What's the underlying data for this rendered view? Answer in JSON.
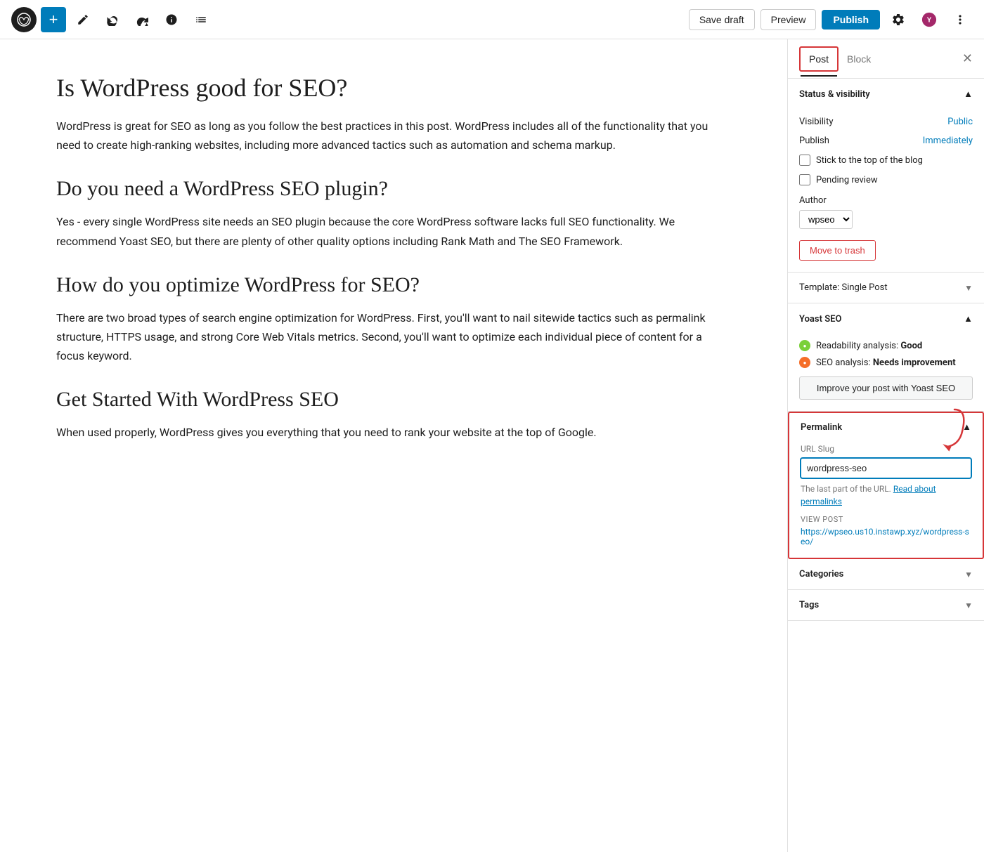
{
  "toolbar": {
    "add_label": "+",
    "save_draft_label": "Save draft",
    "preview_label": "Preview",
    "publish_label": "Publish"
  },
  "editor": {
    "sections": [
      {
        "heading": "Is WordPress good for SEO?",
        "body": "WordPress is great for SEO as long as you follow the best practices in this post. WordPress includes all of the functionality that you need to create high-ranking websites, including more advanced tactics such as automation and schema markup."
      },
      {
        "heading": "Do you need a WordPress SEO plugin?",
        "body": "Yes - every single WordPress site needs an SEO plugin because the core WordPress software lacks full SEO functionality. We recommend Yoast SEO, but there are plenty of other quality options including Rank Math and The SEO Framework."
      },
      {
        "heading": "How do you optimize WordPress for SEO?",
        "body": "There are two broad types of search engine optimization for WordPress. First, you'll want to nail sitewide tactics such as permalink structure, HTTPS usage, and strong Core Web Vitals metrics. Second, you'll want to optimize each individual piece of content for a focus keyword."
      },
      {
        "heading": "Get Started With WordPress SEO",
        "body": "When used properly, WordPress gives you everything that you need to rank your website at the top of Google."
      }
    ]
  },
  "sidebar": {
    "tabs": {
      "post_label": "Post",
      "block_label": "Block"
    },
    "status_visibility": {
      "heading": "Status & visibility",
      "visibility_label": "Visibility",
      "visibility_value": "Public",
      "publish_label": "Publish",
      "publish_value": "Immediately",
      "stick_top_label": "Stick to the top of the blog",
      "pending_review_label": "Pending review",
      "author_label": "Author",
      "author_value": "wpseo",
      "trash_label": "Move to trash"
    },
    "template": {
      "label": "Template: Single Post"
    },
    "yoast": {
      "heading": "Yoast SEO",
      "readability_label": "Readability analysis: ",
      "readability_value": "Good",
      "seo_label": "SEO analysis: ",
      "seo_value": "Needs improvement",
      "improve_btn": "Improve your post with Yoast SEO"
    },
    "permalink": {
      "heading": "Permalink",
      "slug_label": "URL Slug",
      "slug_value": "wordpress-seo",
      "desc_text": "The last part of the URL. ",
      "read_about_label": "Read about permalinks",
      "view_post_label": "VIEW POST",
      "view_post_url": "https://wpseo.us10.instawp.xyz/wordpress-seo/"
    },
    "categories": {
      "label": "Categories"
    },
    "tags": {
      "label": "Tags"
    }
  }
}
